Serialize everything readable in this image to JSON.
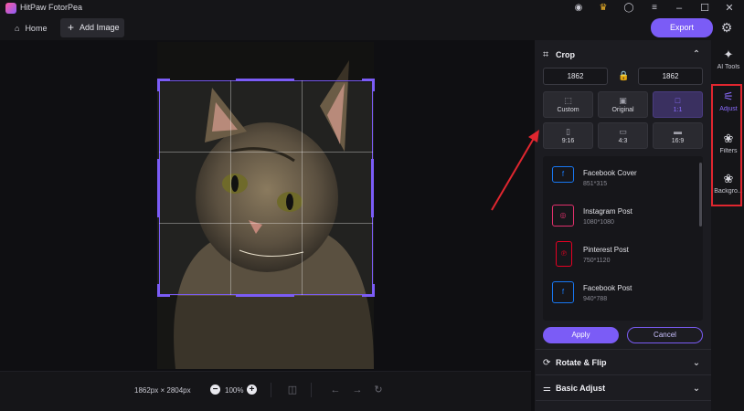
{
  "window": {
    "title": "HitPaw FotorPea"
  },
  "toolbar": {
    "home_label": "Home",
    "add_image_label": "Add Image",
    "export_label": "Export"
  },
  "canvas": {
    "image_dimensions": "1862px × 2804px",
    "zoom": "100%"
  },
  "crop": {
    "title": "Crop",
    "width": "1862",
    "height": "1862",
    "ratios": [
      {
        "label": "Custom",
        "icon": "custom-crop-icon"
      },
      {
        "label": "Original",
        "icon": "image-icon"
      },
      {
        "label": "1:1",
        "icon": "square-icon",
        "active": true
      },
      {
        "label": "9:16",
        "icon": "portrait-icon"
      },
      {
        "label": "4:3",
        "icon": "landscape-icon"
      },
      {
        "label": "16:9",
        "icon": "widescreen-icon"
      }
    ],
    "presets": [
      {
        "name": "Facebook Cover",
        "size": "851*315",
        "color": "#1877f2"
      },
      {
        "name": "Instagram Post",
        "size": "1080*1080",
        "color": "#e1306c"
      },
      {
        "name": "Pinterest Post",
        "size": "750*1120",
        "color": "#e60023"
      },
      {
        "name": "Facebook Post",
        "size": "940*788",
        "color": "#1877f2"
      }
    ],
    "apply_label": "Apply",
    "cancel_label": "Cancel"
  },
  "sections": [
    {
      "label": "Rotate & Flip"
    },
    {
      "label": "Basic Adjust"
    }
  ],
  "rail": [
    {
      "label": "AI Tools"
    },
    {
      "label": "Adjust",
      "active": true
    },
    {
      "label": "Filters"
    },
    {
      "label": "Backgro..."
    }
  ],
  "colors": {
    "accent": "#7b5cf6",
    "annotation": "#e0262f"
  }
}
